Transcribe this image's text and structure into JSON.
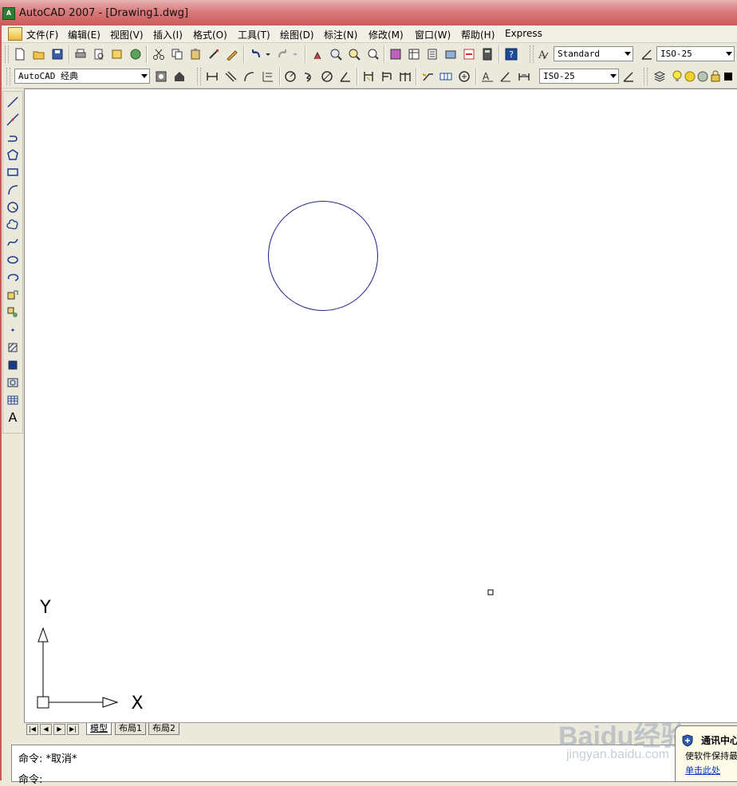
{
  "window": {
    "title": "AutoCAD 2007 - [Drawing1.dwg]",
    "icon": "autocad-app-icon"
  },
  "menu": {
    "items": [
      {
        "label": "文件(F)"
      },
      {
        "label": "编辑(E)"
      },
      {
        "label": "视图(V)"
      },
      {
        "label": "插入(I)"
      },
      {
        "label": "格式(O)"
      },
      {
        "label": "工具(T)"
      },
      {
        "label": "绘图(D)"
      },
      {
        "label": "标注(N)"
      },
      {
        "label": "修改(M)"
      },
      {
        "label": "窗口(W)"
      },
      {
        "label": "帮助(H)"
      },
      {
        "label": "Express"
      }
    ]
  },
  "toolbar1": {
    "text_style": "Standard",
    "dim_style": "ISO-25"
  },
  "toolbar2": {
    "workspace": "AutoCAD 经典",
    "dim_style": "ISO-25"
  },
  "drawing": {
    "circle_color": "#1e1e8c",
    "ucs_y_label": "Y",
    "ucs_x_label": "X"
  },
  "tabs": {
    "model": "模型",
    "layout1": "布局1",
    "layout2": "布局2"
  },
  "command": {
    "line1": "命令:  *取消*",
    "line2": "命令:"
  },
  "watermark": {
    "brand": "Baidu经验",
    "url": "jingyan.baidu.com"
  },
  "notification": {
    "title": "通讯中心",
    "body": "使软件保持最",
    "link": "单击此处"
  }
}
